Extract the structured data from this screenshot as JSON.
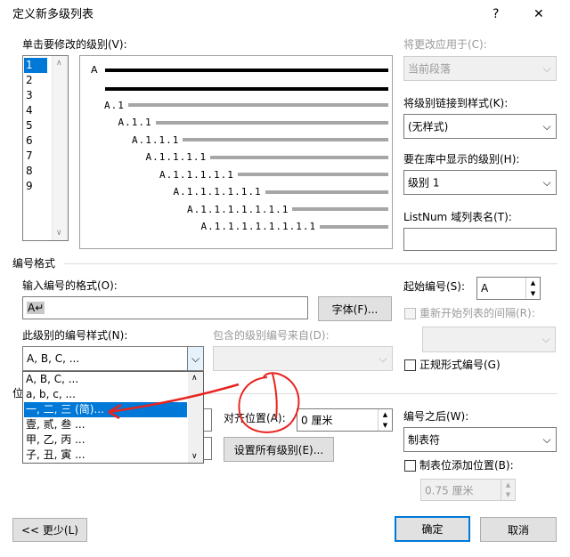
{
  "dialog": {
    "title": "定义新多级列表",
    "help_label": "?",
    "close_label": "✕"
  },
  "level_select": {
    "label": "单击要修改的级别(V):",
    "items": [
      "1",
      "2",
      "3",
      "4",
      "5",
      "6",
      "7",
      "8",
      "9"
    ],
    "selected_index": 0
  },
  "preview": {
    "level1_label": "A",
    "rows": [
      "A.1",
      "A.1.1",
      "A.1.1.1",
      "A.1.1.1.1",
      "A.1.1.1.1.1",
      "A.1.1.1.1.1.1",
      "A.1.1.1.1.1.1.1",
      "A.1.1.1.1.1.1.1.1"
    ]
  },
  "apply_to": {
    "label": "将更改应用于(C):",
    "value": "当前段落"
  },
  "link_style": {
    "label": "将级别链接到样式(K):",
    "value": "(无样式)"
  },
  "gallery_level": {
    "label": "要在库中显示的级别(H):",
    "value": "级别 1"
  },
  "listnum": {
    "label": "ListNum 域列表名(T):",
    "value": ""
  },
  "number_format_group": {
    "title": "编号格式",
    "format_label": "输入编号的格式(O):",
    "format_value": "A↵",
    "font_button": "字体(F)...",
    "start_at_label": "起始编号(S):",
    "start_at_value": "A",
    "restart_label": "重新开始列表的间隔(R):",
    "style_label": "此级别的编号样式(N):",
    "style_value": "A, B, C, ...",
    "include_label": "包含的级别编号来自(D):",
    "legal_label": "正规形式编号(G)",
    "style_options": [
      "A, B, C, ...",
      "a, b, c, ...",
      "一, 二, 三 (简)...",
      "壹, 贰, 叁 ...",
      "甲, 乙, 丙 ...",
      "子, 丑, 寅 ..."
    ],
    "selected_option": 2
  },
  "position_group": {
    "title_fragment": "位",
    "align_label": "对齐位置(A):",
    "align_value": "0 厘米",
    "set_all_button": "设置所有级别(E)...",
    "follow_label": "编号之后(W):",
    "follow_value": "制表符",
    "tab_add_label": "制表位添加位置(B):",
    "tab_add_value": "0.75 厘米"
  },
  "footer": {
    "less_button": "<< 更少(L)",
    "ok_button": "确定",
    "cancel_button": "取消"
  },
  "colors": {
    "selection": "#0078d7",
    "annotation": "#e8231f"
  }
}
